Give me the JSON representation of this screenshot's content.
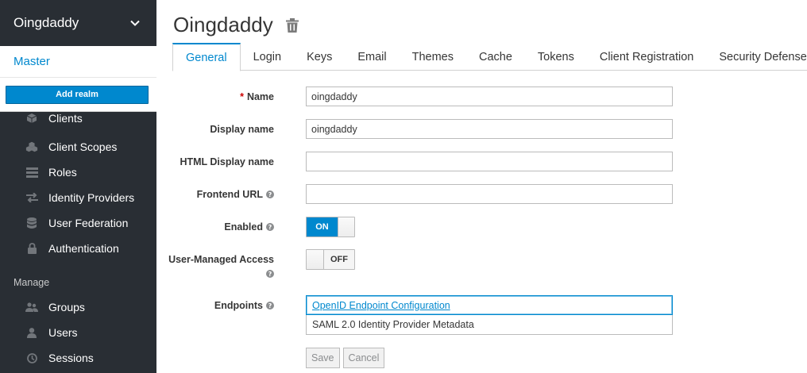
{
  "sidebar": {
    "realm_name": "Oingdaddy",
    "realm_option": "Master",
    "add_realm_label": "Add realm",
    "items": [
      {
        "label": "Clients",
        "icon": "cube-icon"
      },
      {
        "label": "Client Scopes",
        "icon": "cubes-icon"
      },
      {
        "label": "Roles",
        "icon": "list-icon"
      },
      {
        "label": "Identity Providers",
        "icon": "exchange-icon"
      },
      {
        "label": "User Federation",
        "icon": "database-icon"
      },
      {
        "label": "Authentication",
        "icon": "lock-icon"
      }
    ],
    "manage_heading": "Manage",
    "manage_items": [
      {
        "label": "Groups",
        "icon": "users-icon"
      },
      {
        "label": "Users",
        "icon": "user-icon"
      },
      {
        "label": "Sessions",
        "icon": "clock-icon"
      }
    ]
  },
  "header": {
    "title": "Oingdaddy"
  },
  "tabs": [
    {
      "label": "General",
      "active": true
    },
    {
      "label": "Login"
    },
    {
      "label": "Keys"
    },
    {
      "label": "Email"
    },
    {
      "label": "Themes"
    },
    {
      "label": "Cache"
    },
    {
      "label": "Tokens"
    },
    {
      "label": "Client Registration"
    },
    {
      "label": "Security Defenses"
    }
  ],
  "form": {
    "name_label": "Name",
    "required_mark": "*",
    "name_value": "oingdaddy",
    "display_name_label": "Display name",
    "display_name_value": "oingdaddy",
    "html_display_name_label": "HTML Display name",
    "html_display_name_value": "",
    "frontend_url_label": "Frontend URL",
    "frontend_url_value": "",
    "enabled_label": "Enabled",
    "enabled_state": "ON",
    "uma_label": "User-Managed Access",
    "uma_state": "OFF",
    "endpoints_label": "Endpoints",
    "endpoints": [
      "OpenID Endpoint Configuration",
      "SAML 2.0 Identity Provider Metadata"
    ],
    "save_label": "Save",
    "cancel_label": "Cancel"
  },
  "colors": {
    "accent": "#0088ce",
    "sidebar_bg": "#292e34"
  }
}
